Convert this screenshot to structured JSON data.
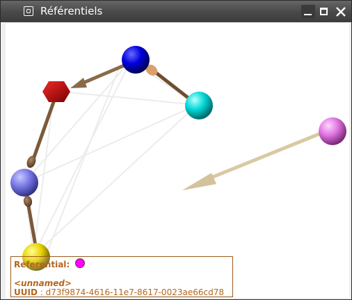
{
  "window": {
    "title": "Référentiels",
    "controls": [
      "minimize",
      "maximize",
      "close"
    ]
  },
  "scene": {
    "nodes": [
      {
        "id": "blue",
        "color": "#0000dd",
        "shape": "sphere"
      },
      {
        "id": "red",
        "color": "#cc0000",
        "shape": "hexagon"
      },
      {
        "id": "cyan",
        "color": "#00dddd",
        "shape": "sphere"
      },
      {
        "id": "magenta",
        "color": "#e070e0",
        "shape": "sphere"
      },
      {
        "id": "slate",
        "color": "#7a7ae6",
        "shape": "sphere"
      },
      {
        "id": "yellow",
        "color": "#e6d200",
        "shape": "sphere"
      }
    ],
    "arrow_colors": {
      "dark": "#7a5a3a",
      "light": "#d8c8a0",
      "tip": "#d6a06a"
    }
  },
  "info": {
    "referential_label": "Referential:",
    "referential_color": "#ff00ff",
    "name": "<unnamed>",
    "uuid_label": "UUID",
    "uuid_separator": " : ",
    "uuid_value": "d73f9874-4616-11e7-8617-0023ae66cd78"
  }
}
